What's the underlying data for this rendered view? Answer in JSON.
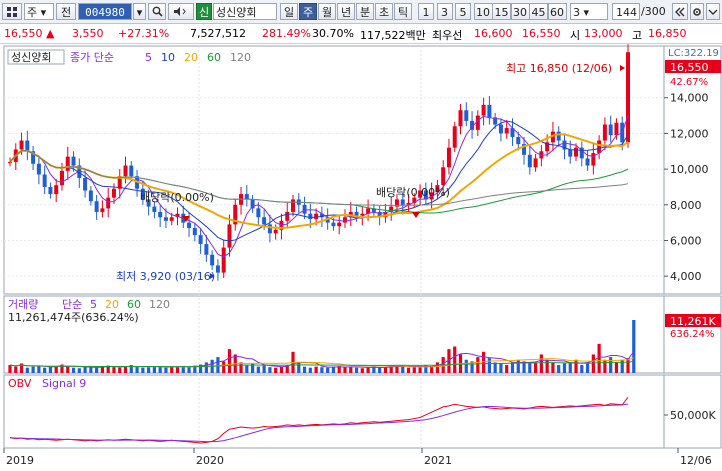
{
  "toolbar": {
    "menu_symbol": "주",
    "prev_label": "전",
    "stock_code": "004980",
    "badge_label": "신",
    "stock_name": "성신양회",
    "period_tabs": [
      "일",
      "주",
      "월",
      "년",
      "분",
      "초",
      "틱"
    ],
    "active_period": "주",
    "interval_options": [
      "1",
      "3",
      "5",
      "10",
      "15",
      "30",
      "45",
      "60"
    ],
    "interval_select_value": "3",
    "bar_count": "144",
    "bar_total": "/300"
  },
  "quote": {
    "price": "16,550",
    "change": "3,550",
    "change_pct": "+27.31%",
    "volume": "7,527,512",
    "volume_ratio": "281.49%",
    "turnover": "30.70%",
    "trade_value": "117,522백만",
    "priority_label": "최우선",
    "ask": "16,600",
    "bid": "16,550",
    "open_label": "시",
    "open": "13,000",
    "high_label": "고",
    "high": "16,850"
  },
  "chart_data": [
    {
      "type": "candlestick",
      "legend_title": "성신양회",
      "ma_label": "종가 단순",
      "ma_periods": [
        "5",
        "10",
        "20",
        "60",
        "120"
      ],
      "ma_colors": [
        "#8a2be2",
        "#1f3fbf",
        "#f0a800",
        "#1a9a3a",
        "#808080"
      ],
      "up_color": "#e8001a",
      "down_color": "#1f5fd6",
      "ylim": [
        3000,
        16900
      ],
      "yticks": [
        "14,000",
        "12,000",
        "10,000",
        "8,000",
        "6,000",
        "4,000"
      ],
      "lc_label": "LC:322.19",
      "current_price": "16,550",
      "current_change": "42.67%",
      "annotations": {
        "high": "최고 16,850 (12/06)",
        "low": "최저 3,920 (03/16)",
        "dividend_1": "배당락(0.00%)",
        "dividend_2": "배당락(0.00%)"
      },
      "price_series": [
        10.4,
        11.1,
        11.6,
        11.0,
        10.3,
        9.7,
        9.0,
        8.6,
        9.1,
        9.9,
        10.7,
        10.2,
        9.5,
        8.8,
        8.2,
        7.6,
        7.8,
        8.4,
        8.9,
        9.6,
        10.2,
        9.6,
        8.9,
        8.3,
        7.9,
        7.6,
        7.3,
        7.1,
        7.3,
        7.5,
        7.0,
        6.7,
        6.3,
        5.8,
        5.2,
        4.6,
        4.2,
        5.6,
        6.9,
        8.0,
        8.6,
        8.3,
        7.8,
        7.3,
        6.9,
        6.4,
        6.6,
        7.1,
        7.6,
        8.3,
        8.0,
        7.5,
        7.2,
        7.5,
        7.3,
        7.0,
        6.8,
        7.0,
        7.3,
        7.6,
        7.4,
        7.5,
        7.8,
        7.6,
        7.3,
        7.6,
        7.9,
        8.3,
        8.0,
        8.1,
        8.4,
        8.8,
        8.3,
        8.7,
        9.1,
        10.1,
        11.2,
        12.4,
        13.3,
        12.7,
        12.2,
        13.0,
        13.6,
        12.9,
        12.5,
        12.0,
        12.3,
        11.8,
        11.4,
        10.8,
        10.1,
        10.6,
        11.0,
        11.5,
        12.1,
        11.6,
        11.1,
        10.7,
        11.2,
        10.6,
        10.2,
        10.9,
        11.6,
        12.5,
        11.9,
        12.6,
        11.5,
        16.55
      ]
    },
    {
      "type": "bar",
      "legend_title": "거래량",
      "ma_label": "단순",
      "ma_periods": [
        "5",
        "20",
        "60",
        "120"
      ],
      "volume_text": "11,261,474주(636.24%)",
      "current_value": "11,261K",
      "current_ratio": "636.24%",
      "values": [
        0.15,
        0.12,
        0.18,
        0.1,
        0.12,
        0.14,
        0.1,
        0.11,
        0.13,
        0.16,
        0.12,
        0.1,
        0.09,
        0.11,
        0.13,
        0.1,
        0.12,
        0.14,
        0.11,
        0.1,
        0.13,
        0.15,
        0.12,
        0.1,
        0.11,
        0.13,
        0.12,
        0.1,
        0.11,
        0.12,
        0.13,
        0.11,
        0.14,
        0.16,
        0.2,
        0.25,
        0.3,
        0.22,
        0.45,
        0.35,
        0.2,
        0.15,
        0.18,
        0.12,
        0.14,
        0.11,
        0.1,
        0.12,
        0.15,
        0.4,
        0.2,
        0.12,
        0.1,
        0.12,
        0.11,
        0.1,
        0.12,
        0.13,
        0.11,
        0.12,
        0.1,
        0.09,
        0.11,
        0.12,
        0.1,
        0.11,
        0.13,
        0.15,
        0.12,
        0.1,
        0.11,
        0.13,
        0.15,
        0.12,
        0.2,
        0.3,
        0.45,
        0.5,
        0.35,
        0.25,
        0.22,
        0.3,
        0.4,
        0.28,
        0.2,
        0.18,
        0.15,
        0.2,
        0.25,
        0.22,
        0.18,
        0.2,
        0.35,
        0.25,
        0.2,
        0.15,
        0.18,
        0.2,
        0.25,
        0.15,
        0.2,
        0.35,
        0.55,
        0.25,
        0.3,
        0.2,
        0.25,
        0.28,
        1.0
      ]
    },
    {
      "type": "line",
      "legend_title": "OBV",
      "signal_label": "Signal 9",
      "ytick": "50,000K",
      "obv_values": [
        0.12,
        0.1,
        0.11,
        0.09,
        0.1,
        0.08,
        0.09,
        0.08,
        0.07,
        0.08,
        0.09,
        0.08,
        0.07,
        0.06,
        0.07,
        0.06,
        0.07,
        0.08,
        0.07,
        0.08,
        0.09,
        0.08,
        0.07,
        0.06,
        0.07,
        0.06,
        0.05,
        0.06,
        0.07,
        0.06,
        0.05,
        0.04,
        0.03,
        0.02,
        0.03,
        0.05,
        0.1,
        0.2,
        0.28,
        0.3,
        0.32,
        0.31,
        0.3,
        0.31,
        0.33,
        0.32,
        0.33,
        0.34,
        0.36,
        0.35,
        0.36,
        0.35,
        0.36,
        0.37,
        0.36,
        0.37,
        0.38,
        0.37,
        0.38,
        0.4,
        0.39,
        0.4,
        0.41,
        0.42,
        0.41,
        0.42,
        0.43,
        0.44,
        0.45,
        0.46,
        0.48,
        0.5,
        0.55,
        0.6,
        0.65,
        0.7,
        0.72,
        0.75,
        0.73,
        0.71,
        0.7,
        0.69,
        0.7,
        0.68,
        0.67,
        0.66,
        0.67,
        0.68,
        0.67,
        0.66,
        0.68,
        0.7,
        0.71,
        0.7,
        0.69,
        0.7,
        0.71,
        0.72,
        0.71,
        0.72,
        0.73,
        0.74,
        0.75,
        0.73,
        0.76,
        0.75,
        0.74,
        0.88
      ],
      "x_labels": [
        "2019",
        "2020",
        "2021",
        "12/06"
      ]
    }
  ]
}
